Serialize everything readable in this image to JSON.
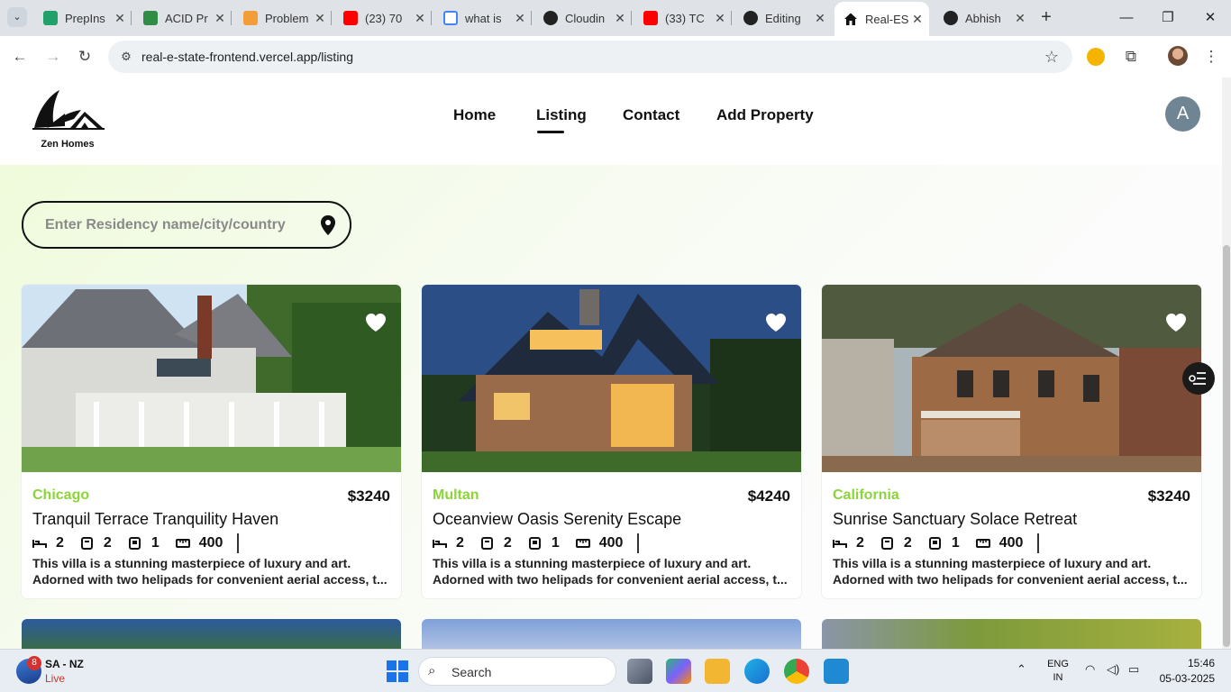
{
  "browser": {
    "tabs": [
      {
        "title": "PrepIns",
        "fav_color": "#22a06b"
      },
      {
        "title": "ACID Pr",
        "fav_color": "#2f8d46"
      },
      {
        "title": "Problem",
        "fav_color": "#f29d38"
      },
      {
        "title": "(23) 70",
        "fav_color": "#ff0000"
      },
      {
        "title": "what is",
        "fav_color": "#4285f4"
      },
      {
        "title": "Cloudin",
        "fav_color": "#222222"
      },
      {
        "title": "(33) TC",
        "fav_color": "#ff0000"
      },
      {
        "title": "Editing",
        "fav_color": "#222222"
      },
      {
        "title": "Real-ES",
        "fav_color": "#111111"
      },
      {
        "title": "Abhish",
        "fav_color": "#222222"
      }
    ],
    "active_tab_index": 8,
    "url": "real-e-state-frontend.vercel.app/listing"
  },
  "site": {
    "logo_text": "Zen Homes",
    "nav": [
      {
        "label": "Home"
      },
      {
        "label": "Listing"
      },
      {
        "label": "Contact"
      },
      {
        "label": "Add Property"
      }
    ],
    "active_nav": "Listing",
    "avatar_letter": "A",
    "search_placeholder": "Enter Residency name/city/country"
  },
  "listings": [
    {
      "city": "Chicago",
      "price": "$3240",
      "title": "Tranquil Terrace Tranquility Haven",
      "beds": "2",
      "baths": "2",
      "parking": "1",
      "area": "400",
      "desc_line1": "This villa is a stunning masterpiece of luxury and art.",
      "desc_line2": "Adorned with two helipads for convenient aerial access, t..."
    },
    {
      "city": "Multan",
      "price": "$4240",
      "title": "Oceanview Oasis Serenity Escape",
      "beds": "2",
      "baths": "2",
      "parking": "1",
      "area": "400",
      "desc_line1": "This villa is a stunning masterpiece of luxury and art.",
      "desc_line2": "Adorned with two helipads for convenient aerial access, t..."
    },
    {
      "city": "California",
      "price": "$3240",
      "title": "Sunrise Sanctuary Solace Retreat",
      "beds": "2",
      "baths": "2",
      "parking": "1",
      "area": "400",
      "desc_line1": "This villa is a stunning masterpiece of luxury and art.",
      "desc_line2": "Adorned with two helipads for convenient aerial access, t..."
    }
  ],
  "colors": {
    "accent_city": "#8bd43a",
    "page_bg_tint": "#eefbd8"
  },
  "taskbar": {
    "weather_badge": "8",
    "weather_title": "SA - NZ",
    "weather_sub": "Live",
    "search_label": "Search",
    "lang_top": "ENG",
    "lang_bottom": "IN",
    "time": "15:46",
    "date": "05-03-2025"
  }
}
